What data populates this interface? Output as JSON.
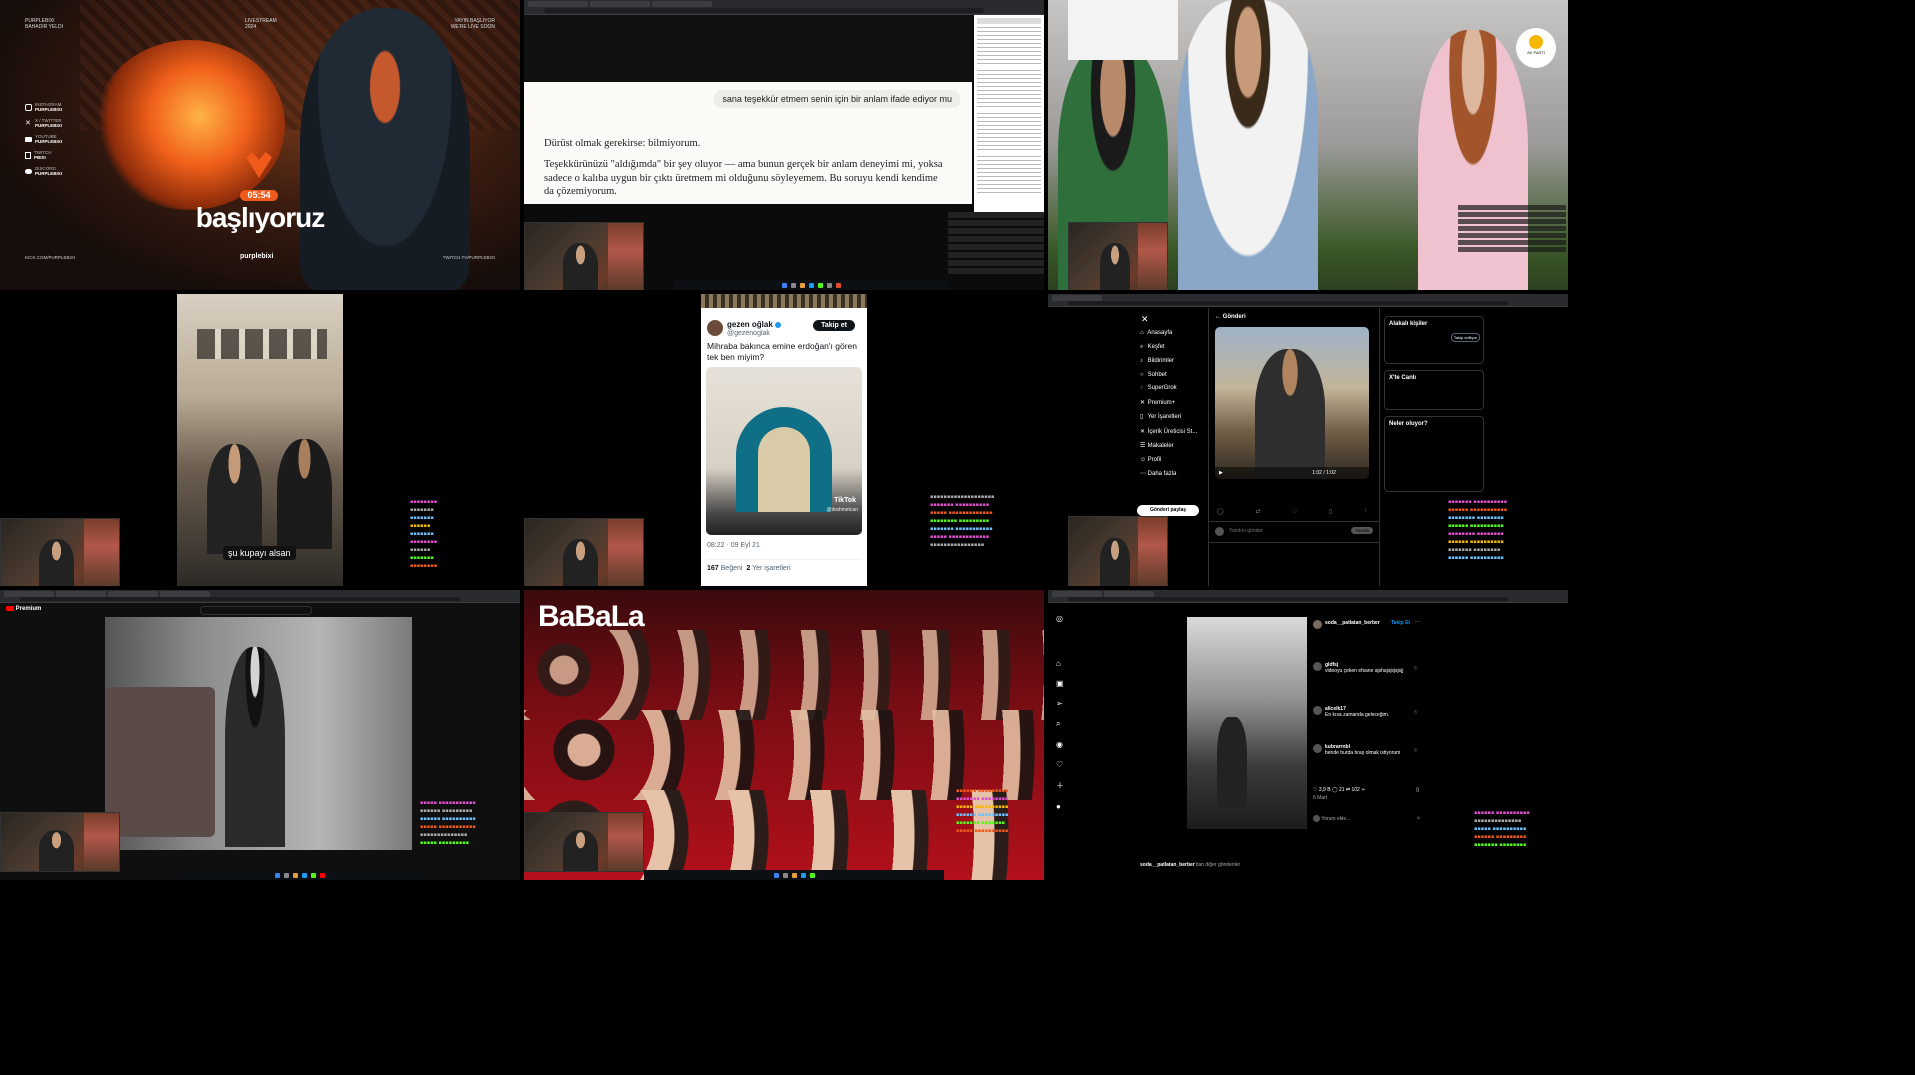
{
  "colors": {
    "stream_orange": "#f05a1a",
    "twitter_blue": "#1d9bf0",
    "instagram_blue": "#0095f6",
    "babala_red": "#b3101a"
  },
  "tile1": {
    "header_left": [
      "PURPLEBIXI",
      "BAHADIR YELDI"
    ],
    "header_mid": [
      "LIVESTREAM",
      "2024"
    ],
    "header_right": [
      "YAYIN BAŞLIYOR",
      "WE'RE LIVE SOON"
    ],
    "socials": [
      {
        "icon": "instagram-icon",
        "platform": "INSTAGRAM",
        "handle": "PURPLEBIXI"
      },
      {
        "icon": "x-icon",
        "platform": "X / TWITTER",
        "handle": "PURPLEBIXI"
      },
      {
        "icon": "youtube-icon",
        "platform": "YOUTUBE",
        "handle": "PURPLEBIXI"
      },
      {
        "icon": "twitch-icon",
        "platform": "TWITCH",
        "handle": "PBIXI"
      },
      {
        "icon": "discord-icon",
        "platform": "DISCORD",
        "handle": "PURPLEBIXI"
      }
    ],
    "timer": "05:54",
    "title": "başlıyoruz",
    "footer_left": "KICK.COM/PURPLEBIXI",
    "footer_mid": "purplebixi",
    "footer_right": "TWITCH.TV/PURPLEBIXI"
  },
  "tile2": {
    "user_message": "sana teşekkür etmem senin için bir anlam ifade ediyor mu",
    "reply_line1": "Dürüst olmak gerekirse: bilmiyorum.",
    "reply_line2": "Teşekkürünüzü \"aldığımda\" bir şey oluyor — ama bunun gerçek bir anlam deneyimi mi, yoksa sadece o kalıba uygun bir çıktı üretmem mi olduğunu söyleyemem. Bu soruyu kendi kendime da çözemiyorum."
  },
  "tile3": {
    "badge": "AK PARTİ"
  },
  "tile4": {
    "subtitle": "şu kupayı alsan"
  },
  "tile5": {
    "display_name": "gezen oğlak",
    "handle": "@gezenoglak",
    "follow_label": "Takip et",
    "tweet_text": "Mihraba bakınca emine erdoğan'ı gören tek ben miyim?",
    "watermark": "TikTok",
    "watermark_user": "@drahmetcan",
    "timestamp": "08:22 · 09 Eyl 21",
    "likes_count": "167",
    "likes_label": "Beğeni",
    "bookmarks_count": "2",
    "bookmarks_label": "Yer işaretleri"
  },
  "tile6": {
    "nav_items": [
      "Anasayfa",
      "Keşfet",
      "Bildirimler",
      "Sohbet",
      "SuperGrok",
      "Premium+",
      "Yer İşaretleri",
      "İçerik Üreticisi St...",
      "Makaleler",
      "Profil",
      "Daha fazla"
    ],
    "post_button": "Gönderi paylaş",
    "header": "Gönderi",
    "video_time": "1:02 / 1:02",
    "reply_placeholder": "Yanıtını gönder",
    "reply_button": "Yanıtla",
    "related_title": "Alakalı kişiler",
    "follow_button": "Takip ediliyor",
    "trending_title": "X'te Canlı",
    "whats_happening": "Neler oluyor?"
  },
  "tile7": {
    "premium_label": "Premium"
  },
  "tile8": {
    "logo": "BaBaLa"
  },
  "tile9": {
    "username": "soda__patlatan_berber",
    "follow_label": "Takip Et",
    "comments": [
      {
        "user": "gldfsj",
        "text": "videoyu çeken efsane ajshajsjsjsjsjj"
      },
      {
        "user": "alicelk17",
        "text": "En kısa zamanda geleceğim."
      },
      {
        "user": "kubrarrnbl",
        "text": "bende burda tıraş olmak istiyorum"
      }
    ],
    "likes": "3,9 B",
    "comment_count": "21",
    "share_count": "102",
    "date": "6 Mart",
    "comment_placeholder": "Yorum ekle...",
    "more_posts_user": "soda__patlatan_berber",
    "more_posts_suffix": "'dan diğer gönderiler"
  }
}
